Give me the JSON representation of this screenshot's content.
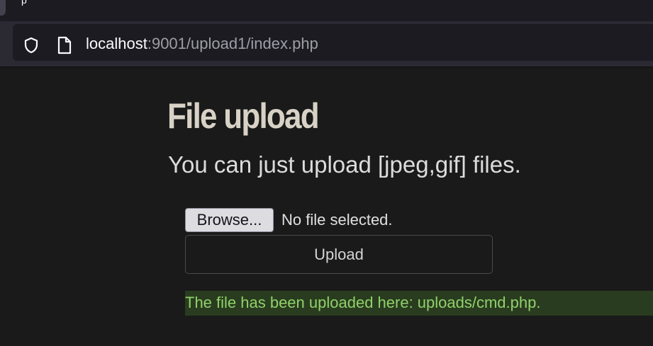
{
  "browser": {
    "url_host": "localhost",
    "url_rest": ":9001/upload1/index.php",
    "tab_fragment": "p"
  },
  "page": {
    "title": "File upload",
    "subtitle": "You can just upload [jpeg,gif] files.",
    "browse_label": "Browse...",
    "file_status": "No file selected.",
    "upload_label": "Upload",
    "success_message": "The file has been uploaded here: uploads/cmd.php."
  },
  "colors": {
    "background": "#1a1a1a",
    "success_text": "#8fd16a",
    "success_bg": "#2a3c1f"
  },
  "icons": {
    "site_info": "shield-icon",
    "page": "page-icon"
  }
}
